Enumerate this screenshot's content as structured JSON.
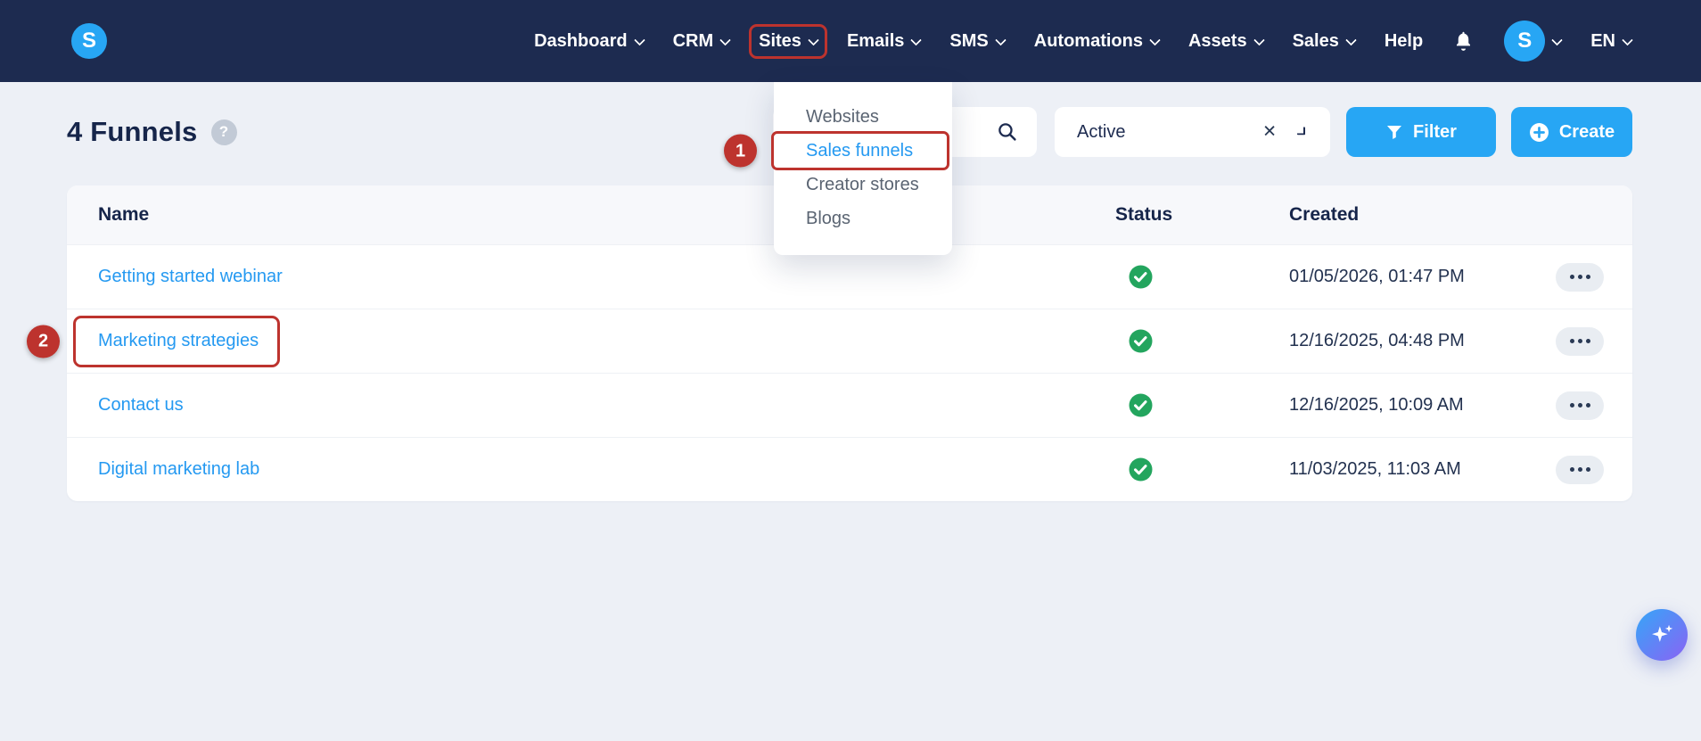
{
  "navbar": {
    "logo_letter": "S",
    "items": [
      {
        "label": "Dashboard"
      },
      {
        "label": "CRM"
      },
      {
        "label": "Sites"
      },
      {
        "label": "Emails"
      },
      {
        "label": "SMS"
      },
      {
        "label": "Automations"
      },
      {
        "label": "Assets"
      },
      {
        "label": "Sales"
      },
      {
        "label": "Help"
      }
    ],
    "avatar_letter": "S",
    "language": "EN"
  },
  "sites_menu": {
    "items": [
      "Websites",
      "Sales funnels",
      "Creator stores",
      "Blogs"
    ],
    "selected": "Sales funnels"
  },
  "annotations": {
    "step1": "1",
    "step2": "2",
    "highlight_color": "#bd332e"
  },
  "header": {
    "title": "4 Funnels",
    "help_label": "?"
  },
  "toolbar": {
    "status_filter_value": "Active",
    "clear_icon": "✕",
    "filter_label": "Filter",
    "create_label": "Create"
  },
  "table": {
    "columns": {
      "name": "Name",
      "status": "Status",
      "created": "Created"
    },
    "rows": [
      {
        "name": "Getting started webinar",
        "status": "active",
        "created": "01/05/2026, 01:47 PM"
      },
      {
        "name": "Marketing strategies",
        "status": "active",
        "created": "12/16/2025, 04:48 PM"
      },
      {
        "name": "Contact us",
        "status": "active",
        "created": "12/16/2025, 10:09 AM"
      },
      {
        "name": "Digital marketing lab",
        "status": "active",
        "created": "11/03/2025, 11:03 AM"
      }
    ]
  },
  "colors": {
    "navbar_bg": "#1d2b50",
    "accent_blue": "#27a6f4",
    "link_blue": "#2499f1",
    "success_green": "#23a55e",
    "annotation_red": "#bd332e",
    "page_bg": "#edf0f6"
  }
}
